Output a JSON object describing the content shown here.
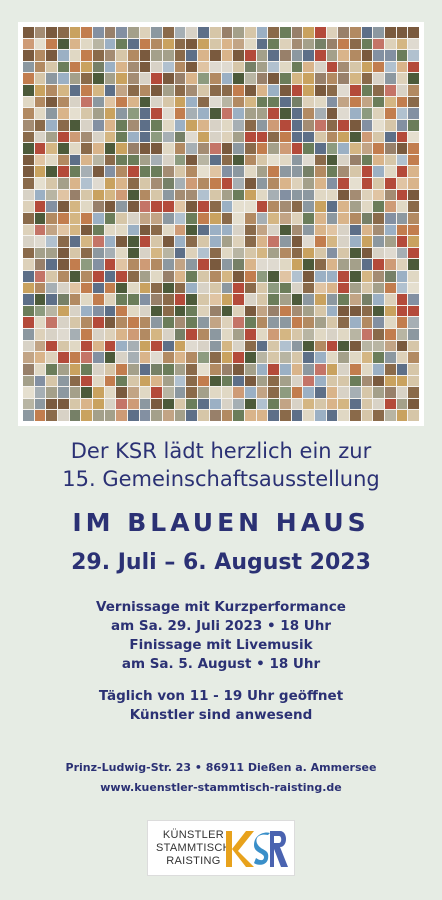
{
  "mosaic": {
    "palette": [
      "#b28a62",
      "#8a6a4a",
      "#d6c6a8",
      "#6b7d5a",
      "#c27d4e",
      "#9bb0c4",
      "#d8d2c6",
      "#7a5a3e",
      "#a4a08a",
      "#c9a25f",
      "#5d6f88",
      "#e0d8c4",
      "#b44a3a",
      "#4c5a3a",
      "#d9b48a",
      "#8c98a0"
    ]
  },
  "invite": {
    "line1": "Der KSR lädt herzlich ein zur",
    "line2": "15. Gemeinschaftsausstellung"
  },
  "exhibition": {
    "title": "IM BLAUEN HAUS",
    "dates": "29. Juli – 6. August 2023"
  },
  "events": {
    "vernissage": "Vernissage mit Kurzperformance",
    "vernissage_date": "am Sa. 29. Juli 2023 • 18 Uhr",
    "finissage": "Finissage mit Livemusik",
    "finissage_date": "am Sa. 5. August • 18 Uhr"
  },
  "hours": {
    "open": "Täglich von 11 - 19 Uhr geöffnet",
    "artists": "Künstler sind anwesend"
  },
  "contact": {
    "address": "Prinz-Ludwig-Str. 23  •  86911 Dießen a. Ammersee",
    "website": "www.kuenstler-stammtisch-raisting.de"
  },
  "logo": {
    "line1": "KÜNSTLER",
    "line2": "STAMMTISCH",
    "line3": "RAISTING",
    "mark": "KSR",
    "colors": [
      "#e8a21c",
      "#3a8fc9",
      "#4a63b0"
    ]
  }
}
